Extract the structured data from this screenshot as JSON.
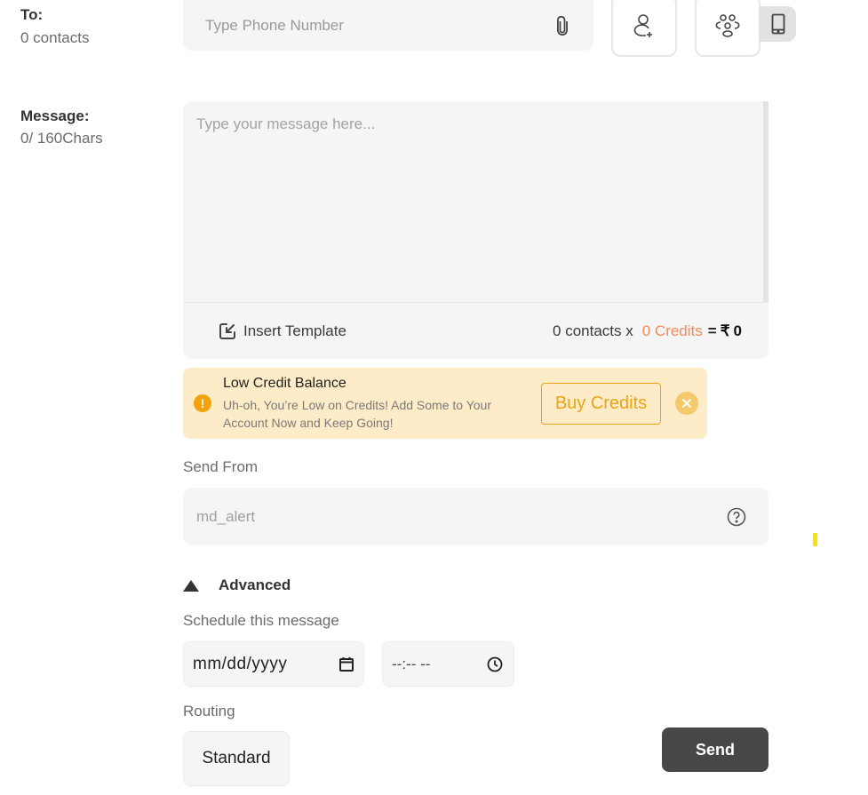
{
  "to": {
    "label": "To:",
    "count": "0 contacts",
    "phone_placeholder": "Type Phone Number",
    "icons": {
      "attach": "paperclip-icon",
      "add_contact": "add-contact-icon",
      "groups": "group-icon",
      "mobile": "mobile-phone-icon"
    }
  },
  "message": {
    "label": "Message:",
    "char_count": "0/ 160Chars",
    "placeholder": "Type your message here...",
    "insert_template_label": "Insert Template",
    "cost": {
      "contacts": "0 contacts x",
      "credits": "0 Credits",
      "equals": "=",
      "currency": "₹",
      "amount": "0"
    }
  },
  "banner": {
    "title": "Low Credit Balance",
    "description": "Uh-oh, You’re Low on Credits! Add Some to Your Account Now and Keep Going!",
    "buy_label": "Buy Credits",
    "colors": {
      "background": "#feebc8",
      "accent": "#e9a516",
      "warning": "#f2a20c"
    }
  },
  "send_from": {
    "label": "Send From",
    "value": "md_alert"
  },
  "advanced": {
    "label": "Advanced",
    "expanded": true,
    "schedule_label": "Schedule this message",
    "date_placeholder": "mm/dd/yyyy",
    "time_placeholder": "--:-- --",
    "routing_label": "Routing",
    "routing_value": "Standard"
  },
  "actions": {
    "send_label": "Send"
  },
  "colors": {
    "credits": "#f08c5a",
    "send_button": "#474747",
    "input_bg": "#f5f5f5"
  }
}
